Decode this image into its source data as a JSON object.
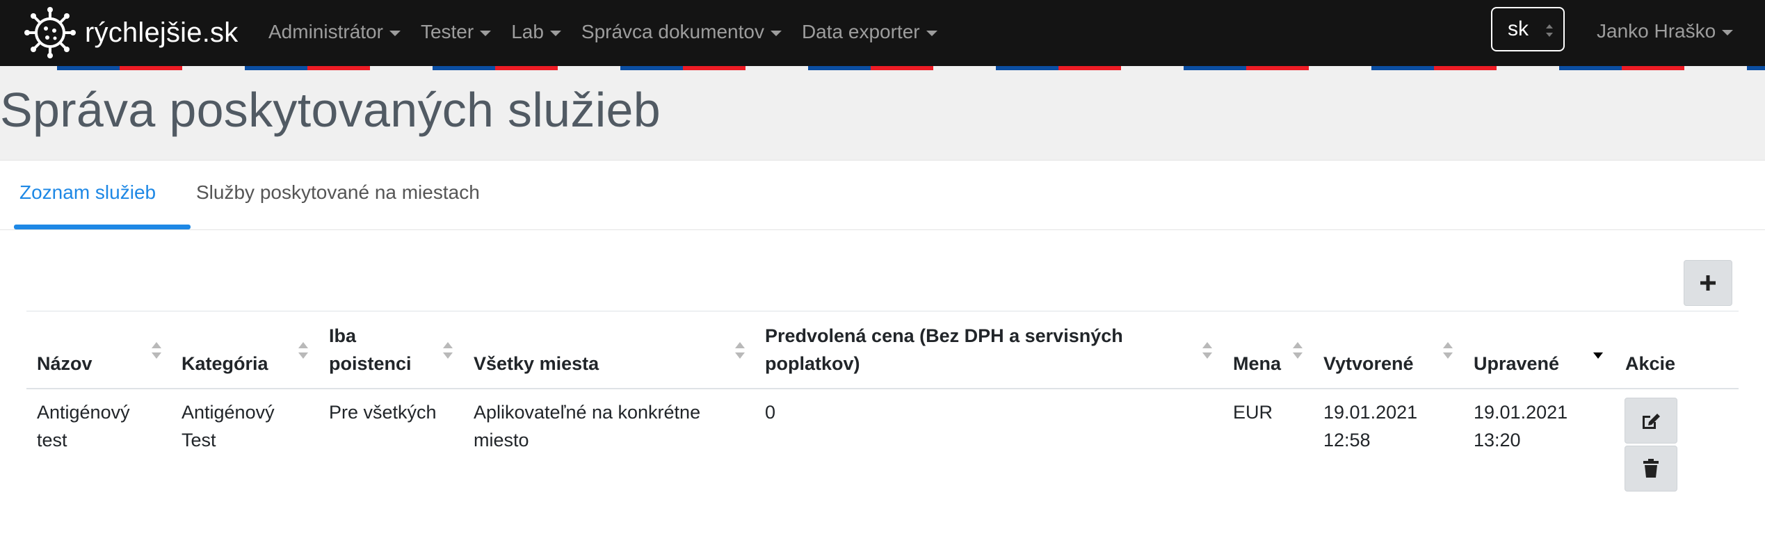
{
  "app": {
    "brand": "rýchlejšie.sk"
  },
  "nav": {
    "items": [
      {
        "label": "Administrátor"
      },
      {
        "label": "Tester"
      },
      {
        "label": "Lab"
      },
      {
        "label": "Správca dokumentov"
      },
      {
        "label": "Data exporter"
      }
    ],
    "language": "sk",
    "user": "Janko Hraško"
  },
  "page": {
    "title": "Správa poskytovaných služieb"
  },
  "tabs": [
    {
      "label": "Zoznam služieb",
      "active": true
    },
    {
      "label": "Služby poskytované na miestach",
      "active": false
    }
  ],
  "toolbar": {
    "add_icon": "plus-icon"
  },
  "table": {
    "columns": [
      {
        "line1": "",
        "line2": "Názov",
        "sortable": true
      },
      {
        "line1": "",
        "line2": "Kategória",
        "sortable": true
      },
      {
        "line1": "Iba",
        "line2": "poistenci",
        "sortable": true
      },
      {
        "line1": "",
        "line2": "Všetky miesta",
        "sortable": true
      },
      {
        "line1": "Predvolená cena (Bez DPH a servisných",
        "line2": "poplatkov)",
        "sortable": true
      },
      {
        "line1": "",
        "line2": "Mena",
        "sortable": true
      },
      {
        "line1": "",
        "line2": "Vytvorené",
        "sortable": true
      },
      {
        "line1": "",
        "line2": "Upravené",
        "sortable": true,
        "sorted": "desc"
      },
      {
        "line1": "",
        "line2": "Akcie",
        "sortable": false
      }
    ],
    "rows": [
      {
        "name": [
          "Antigénový",
          "test"
        ],
        "category": [
          "Antigénový",
          "Test"
        ],
        "insured_only": [
          "Pre všetkých"
        ],
        "all_places": [
          "Aplikovateľné na konkrétne",
          "miesto"
        ],
        "default_price": [
          "0"
        ],
        "currency": [
          "EUR"
        ],
        "created": [
          "19.01.2021",
          "12:58"
        ],
        "updated": [
          "19.01.2021",
          "13:20"
        ],
        "actions": [
          "edit-icon",
          "trash-icon"
        ]
      }
    ]
  },
  "colors": {
    "accent": "#1e88e5",
    "navbar": "#141414",
    "flag_blue": "#0b4ea2",
    "flag_red": "#ee1c25"
  }
}
